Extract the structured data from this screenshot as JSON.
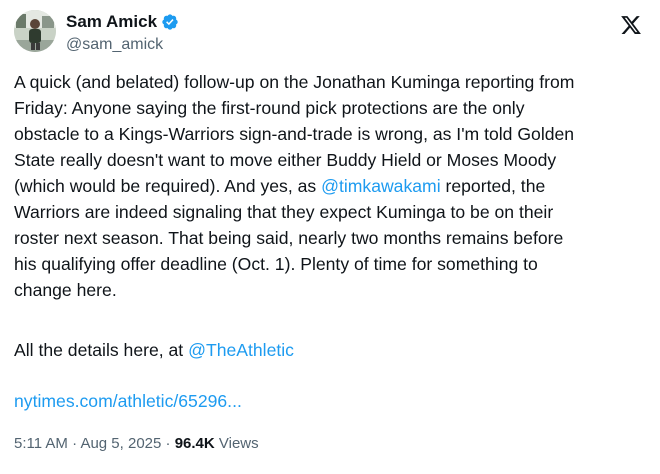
{
  "author": {
    "display_name": "Sam Amick",
    "handle": "@sam_amick"
  },
  "icons": {
    "verified": "verified-badge-icon",
    "platform": "x-logo-icon"
  },
  "colors": {
    "link": "#1d9bf0",
    "secondary_text": "#536471",
    "primary_text": "#0f1419"
  },
  "tweet": {
    "text_part1": "A quick (and belated) follow-up on the Jonathan Kuminga reporting from\nFriday: Anyone saying the first-round pick protections are the only\nobstacle to a Kings-Warriors sign-and-trade is wrong, as I'm told Golden\nState really doesn't want to move either Buddy Hield or Moses Moody\n(which would be required). And yes, as ",
    "mention1": "@timkawakami",
    "text_part2": " reported, the\nWarriors are indeed signaling that they expect Kuminga to be on their\nroster next season. That being said, nearly two months remains before\nhis qualifying offer deadline (Oct. 1). Plenty of time for something to\nchange here.",
    "details_prefix": "All the details here, at ",
    "mention2": "@TheAthletic",
    "url": "nytimes.com/athletic/65296..."
  },
  "meta": {
    "time": "5:11 AM",
    "separator1": " · ",
    "date": "Aug 5, 2025",
    "separator2": " · ",
    "views_count": "96.4K",
    "views_label": " Views"
  }
}
